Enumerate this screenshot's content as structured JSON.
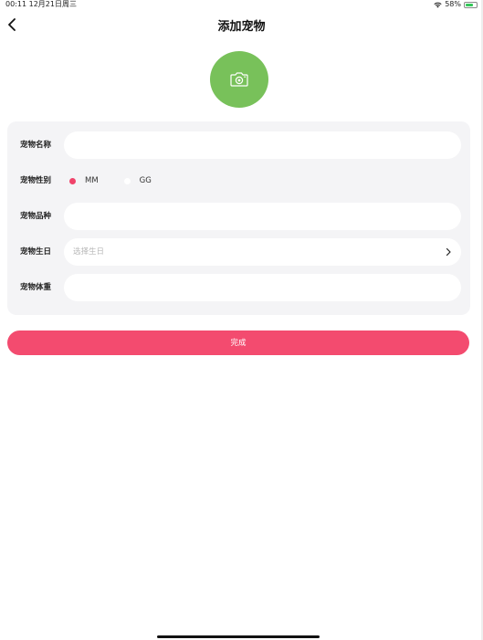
{
  "status_bar": {
    "time_date": "00:11  12月21日周三",
    "battery_percent": "58%",
    "battery_level": 0.58,
    "wifi_icon": "wifi-icon",
    "battery_icon": "battery-icon"
  },
  "nav": {
    "title": "添加宠物",
    "back_icon": "chevron-left-icon"
  },
  "avatar": {
    "icon": "camera-icon",
    "color": "#78c15a"
  },
  "form": {
    "name": {
      "label": "宠物名称",
      "value": ""
    },
    "gender": {
      "label": "宠物性别",
      "options": [
        "MM",
        "GG"
      ],
      "selected": "MM"
    },
    "breed": {
      "label": "宠物品种",
      "value": ""
    },
    "birthday": {
      "label": "宠物生日",
      "placeholder": "选择生日"
    },
    "weight": {
      "label": "宠物体重",
      "value": ""
    }
  },
  "submit": {
    "label": "完成",
    "color": "#f34b6f"
  }
}
